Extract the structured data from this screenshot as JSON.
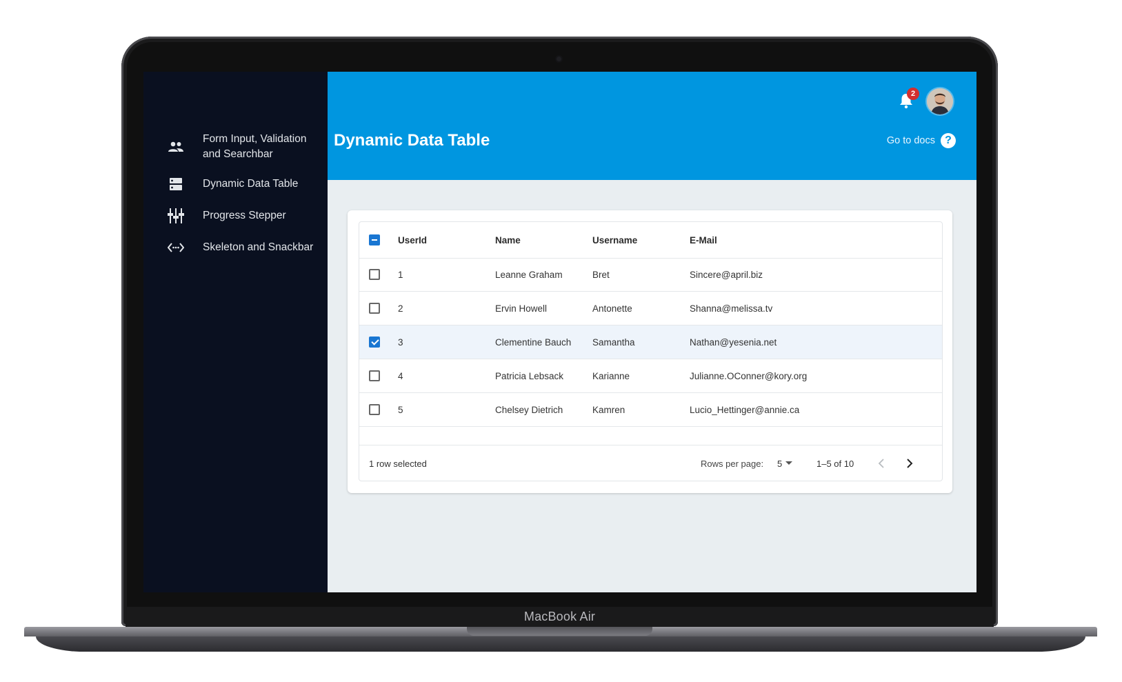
{
  "device": {
    "label": "MacBook Air"
  },
  "sidebar": {
    "items": [
      {
        "label": "Form Input, Validation and Searchbar",
        "icon": "people-icon"
      },
      {
        "label": "Dynamic Data Table",
        "icon": "storage-icon"
      },
      {
        "label": "Progress Stepper",
        "icon": "stepper-icon"
      },
      {
        "label": "Skeleton and Snackbar",
        "icon": "code-icon"
      }
    ]
  },
  "header": {
    "title": "Dynamic Data Table",
    "docs_label": "Go to docs",
    "notifications_count": "2",
    "header_color": "#0096e0"
  },
  "table": {
    "columns": [
      "UserId",
      "Name",
      "Username",
      "E-Mail"
    ],
    "rows": [
      {
        "id": "1",
        "name": "Leanne Graham",
        "username": "Bret",
        "email": "Sincere@april.biz",
        "selected": false
      },
      {
        "id": "2",
        "name": "Ervin Howell",
        "username": "Antonette",
        "email": "Shanna@melissa.tv",
        "selected": false
      },
      {
        "id": "3",
        "name": "Clementine Bauch",
        "username": "Samantha",
        "email": "Nathan@yesenia.net",
        "selected": true
      },
      {
        "id": "4",
        "name": "Patricia Lebsack",
        "username": "Karianne",
        "email": "Julianne.OConner@kory.org",
        "selected": false
      },
      {
        "id": "5",
        "name": "Chelsey Dietrich",
        "username": "Kamren",
        "email": "Lucio_Hettinger@annie.ca",
        "selected": false
      }
    ],
    "selection_status": "1 row selected",
    "rows_per_page_label": "Rows per page:",
    "rows_per_page_value": "5",
    "range_label": "1–5 of 10",
    "accent_color": "#1976d2"
  }
}
